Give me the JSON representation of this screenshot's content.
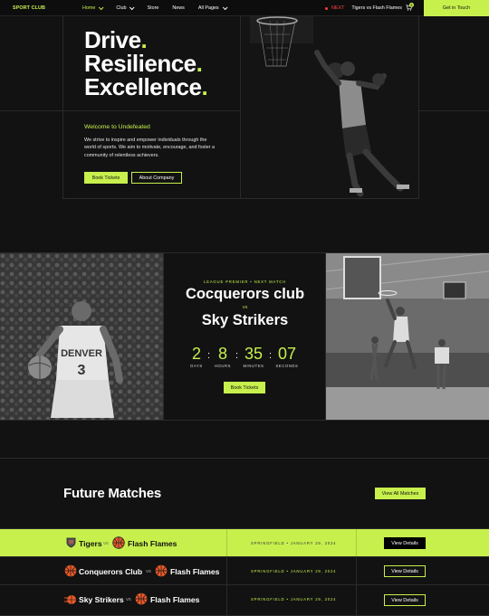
{
  "nav": {
    "brand": "SPORT CLUB",
    "links": [
      "Home",
      "Club",
      "Store",
      "News",
      "All Pages"
    ],
    "next_label": "NEXT",
    "next_match": "Tigers vs Flash Flames",
    "cart_count": "0",
    "cta": "Get in Touch"
  },
  "hero": {
    "line1": "Drive",
    "line2": "Resilience",
    "line3": "Excellence",
    "welcome": "Welcome to Undefeated",
    "description": "We strive to inspire and empower individuals through the world of sports. We aim to motivate, encourage, and foster a community of relentless achievers.",
    "book_tickets": "Book Tickets",
    "about_company": "About Company"
  },
  "next_match": {
    "league": "LEAGUE PREMIER • NEXT MATCH",
    "team1": "Cocquerors club",
    "vs": "VS",
    "team2": "Sky Strikers",
    "countdown": {
      "days": "2",
      "hours": "8",
      "minutes": "35",
      "seconds": "07",
      "days_label": "DAYS",
      "hours_label": "HOURS",
      "minutes_label": "MINUTES",
      "seconds_label": "SECONDS"
    },
    "book_tickets": "Book Tickets"
  },
  "future": {
    "title": "Future Matches",
    "view_all": "View All Matches",
    "matches": [
      {
        "home": "Tigers",
        "away": "Flash Flames",
        "vs": "VS",
        "meta": "SPRINGFIELD  •  JANUARY 29, 2024",
        "cta": "View Details"
      },
      {
        "home": "Conquerors Club",
        "away": "Flash Flames",
        "vs": "VS",
        "meta": "SPRINGFIELD  •  JANUARY 29, 2024",
        "cta": "View Details"
      },
      {
        "home": "Sky Strikers",
        "away": "Flash Flames",
        "vs": "VS",
        "meta": "SPRINGFIELD  •  JANUARY 29, 2024",
        "cta": "View Details"
      }
    ]
  },
  "colors": {
    "accent": "#c7f04d",
    "background": "#121212",
    "live": "#ff4444"
  },
  "icons": [
    "chevron-down-icon",
    "cart-icon",
    "shield-icon",
    "ball-icon"
  ]
}
